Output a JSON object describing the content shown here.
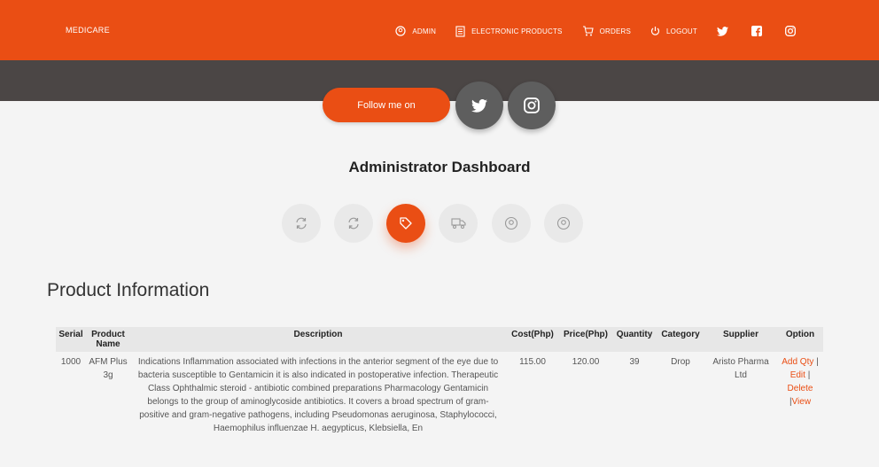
{
  "navbar": {
    "brand": "MEDICARE",
    "items": [
      {
        "label": "ADMIN",
        "icon": "user-circle-icon"
      },
      {
        "label": "ELECTRONIC PRODUCTS",
        "icon": "document-list-icon"
      },
      {
        "label": "ORDERS",
        "icon": "cart-icon"
      },
      {
        "label": "LOGOUT",
        "icon": "power-icon"
      }
    ],
    "social": [
      "twitter-icon",
      "facebook-icon",
      "instagram-icon"
    ]
  },
  "follow": {
    "label": "Follow me on",
    "social": [
      "twitter-icon",
      "instagram-icon"
    ]
  },
  "dashboard": {
    "title": "Administrator Dashboard",
    "actions": [
      {
        "icon": "refresh-icon",
        "active": false
      },
      {
        "icon": "refresh-icon",
        "active": false
      },
      {
        "icon": "tag-icon",
        "active": true
      },
      {
        "icon": "truck-icon",
        "active": false
      },
      {
        "icon": "user-circle-icon",
        "active": false
      },
      {
        "icon": "user-circle-icon",
        "active": false
      }
    ]
  },
  "products": {
    "title": "Product Information",
    "headers": [
      "Serial",
      "Product Name",
      "Description",
      "Cost(Php)",
      "Price(Php)",
      "Quantity",
      "Category",
      "Supplier",
      "Option"
    ],
    "rows": [
      {
        "serial": "1000",
        "name": "AFM Plus 3g",
        "description": "Indications Inflammation associated with infections in the anterior segment of the eye due to bacteria susceptible to Gentamicin it is also indicated in postoperative infection. Therapeutic Class Ophthalmic steroid - antibiotic combined preparations Pharmacology Gentamicin belongs to the group of aminoglycoside antibiotics. It covers a broad spectrum of gram-positive and gram-negative pathogens, including Pseudomonas aeruginosa, Staphylococci, Haemophilus influenzae H. aegypticus, Klebsiella, En",
        "cost": "115.00",
        "price": "120.00",
        "quantity": "39",
        "category": "Drop",
        "supplier": "Aristo Pharma Ltd",
        "options": {
          "add_qty": "Add Qty",
          "sep": "|",
          "edit": "Edit",
          "delete": "Delete",
          "view": "View"
        }
      }
    ]
  },
  "colors": {
    "accent": "#ea4e14",
    "dark_band": "#4b4645",
    "social_circle": "#5e5e5e"
  }
}
